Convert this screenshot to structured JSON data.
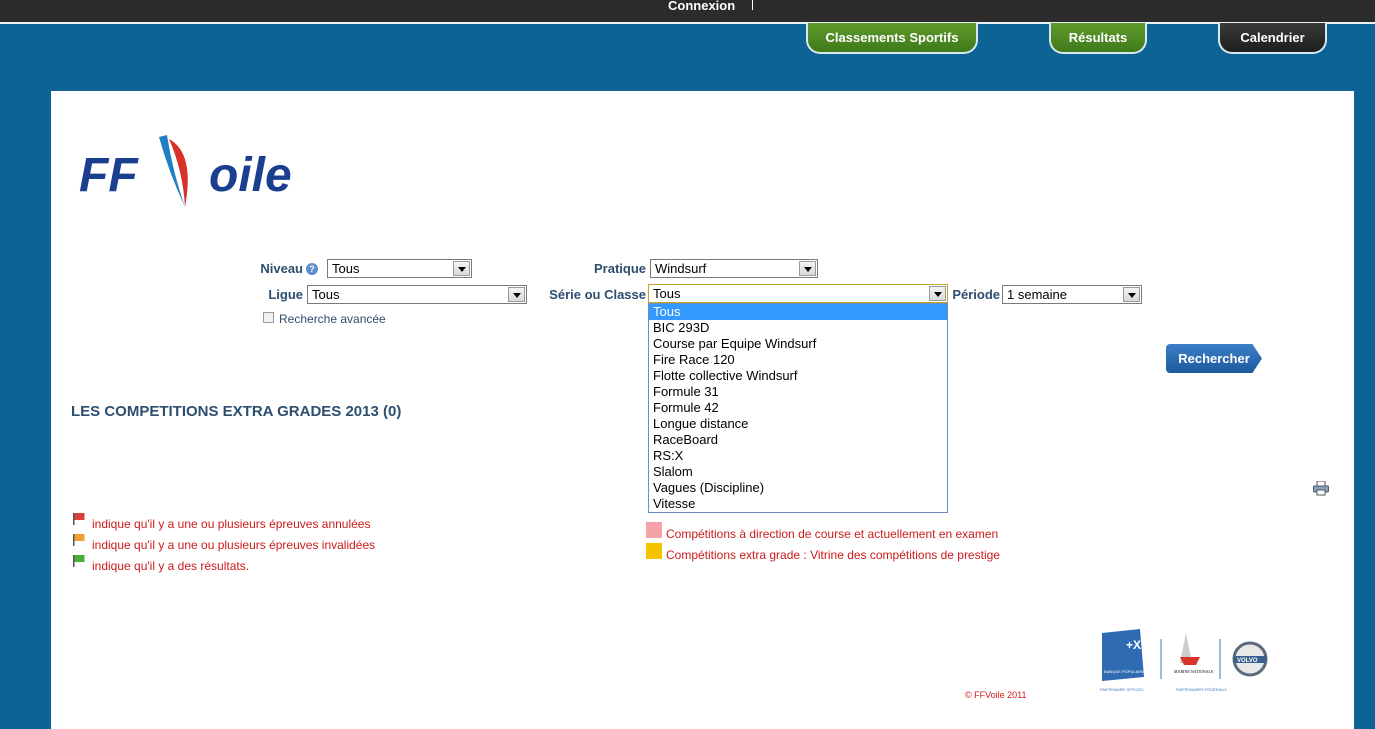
{
  "topbar": {
    "connexion": "Connexion"
  },
  "nav": {
    "tabs": [
      {
        "label": "Classements Sportifs"
      },
      {
        "label": "Résultats"
      },
      {
        "label": "Calendrier"
      }
    ]
  },
  "logo": {
    "text_ff": "FF",
    "text_voile": "oile"
  },
  "form": {
    "niveau_label": "Niveau",
    "niveau_value": "Tous",
    "pratique_label": "Pratique",
    "pratique_value": "Windsurf",
    "ligue_label": "Ligue",
    "ligue_value": "Tous",
    "serie_label": "Série ou Classe",
    "serie_value": "Tous",
    "periode_label": "Période",
    "periode_value": "1 semaine",
    "advanced_label": "Recherche avancée",
    "search_button": "Rechercher"
  },
  "serie_options": [
    "Tous",
    "BIC 293D",
    "Course par Equipe Windsurf",
    "Fire Race 120",
    "Flotte collective Windsurf",
    "Formule 31",
    "Formule 42",
    "Longue distance",
    "RaceBoard",
    "RS:X",
    "Slalom",
    "Vagues (Discipline)",
    "Vitesse"
  ],
  "heading": "LES COMPETITIONS EXTRA GRADES 2013 (0)",
  "legend": {
    "annulees": "indique qu'il y a une ou plusieurs épreuves annulées",
    "invalidees": "indique qu'il y a une ou plusieurs épreuves invalidées",
    "resultats": "indique qu'il y a des résultats.",
    "examen": "Compétitions à direction de course et actuellement en examen",
    "prestige": "Compétitions extra grade : Vitrine des compétitions de prestige"
  },
  "colors": {
    "flag_red": "#d9413c",
    "flag_orange": "#f0a030",
    "flag_green": "#4caf3a",
    "square_pink": "#f4a3a8",
    "square_yellow": "#f5c400"
  },
  "footer": {
    "copyright": "© FFVoile 2011",
    "partner_official": "PARTENAIRE OFFICIEL",
    "partners_federal": "PARTENAIRES FÉDÉRAUX",
    "bp_text": "BANQUE POPULAIRE",
    "marine_text": "MARINE NATIONALE",
    "volvo_text": "VOLVO"
  }
}
